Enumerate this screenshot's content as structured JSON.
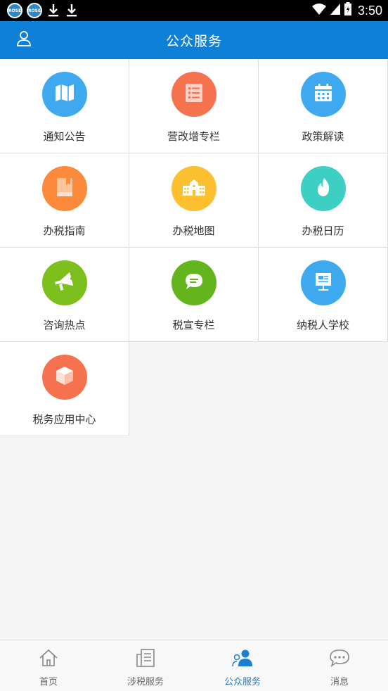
{
  "status_bar": {
    "time": "3:50",
    "notification_icons": [
      "app-notification-icon",
      "app-notification-icon",
      "download-icon",
      "download-icon"
    ]
  },
  "header": {
    "title": "公众服务",
    "profile_icon": "user-icon"
  },
  "grid_items": [
    {
      "label": "通知公告",
      "icon": "map-icon",
      "color": "#3fa9ef"
    },
    {
      "label": "营改增专栏",
      "icon": "list-icon",
      "color": "#f6724f"
    },
    {
      "label": "政策解读",
      "icon": "calendar-icon",
      "color": "#3fa9ef"
    },
    {
      "label": "办税指南",
      "icon": "book-icon",
      "color": "#fb8b3a"
    },
    {
      "label": "办税地图",
      "icon": "building-icon",
      "color": "#fbbf2f"
    },
    {
      "label": "办税日历",
      "icon": "flame-icon",
      "color": "#3ccfc4"
    },
    {
      "label": "咨询热点",
      "icon": "megaphone-icon",
      "color": "#7dbf1c"
    },
    {
      "label": "税宣专栏",
      "icon": "chat-bubble-icon",
      "color": "#62b51c"
    },
    {
      "label": "纳税人学校",
      "icon": "presentation-board-icon",
      "color": "#3fa9ef"
    },
    {
      "label": "税务应用中心",
      "icon": "cube-icon",
      "color": "#f6724f"
    }
  ],
  "tabbar": {
    "items": [
      {
        "label": "首页",
        "icon": "home-icon"
      },
      {
        "label": "涉税服务",
        "icon": "document-icon"
      },
      {
        "label": "公众服务",
        "icon": "people-icon"
      },
      {
        "label": "消息",
        "icon": "message-icon"
      }
    ],
    "active_index": 2,
    "active_color": "#1a7fd1"
  }
}
